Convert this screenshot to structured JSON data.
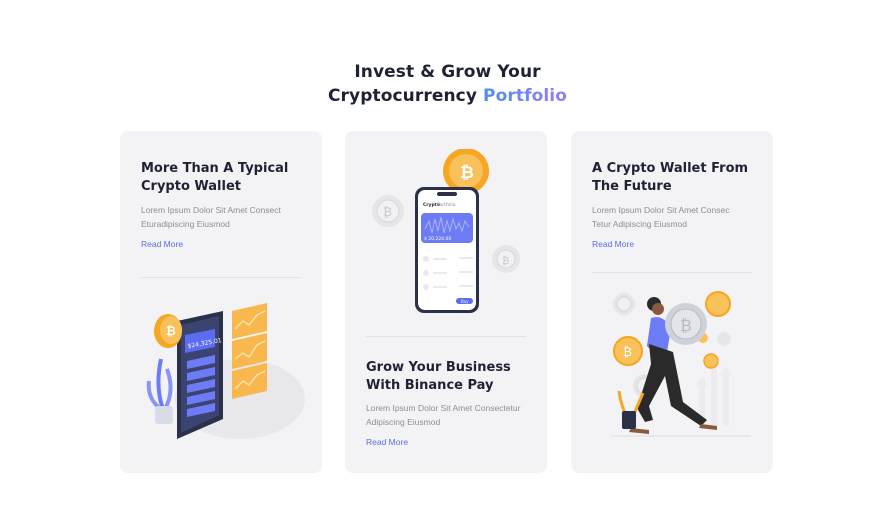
{
  "heading": {
    "line1": "Invest & Grow Your",
    "line2_main": "Cryptocurrency",
    "line2_accent": "Portfolio"
  },
  "cards": [
    {
      "title_line1": "More Than A Typical",
      "title_line2": "Crypto Wallet",
      "desc_line1": "Lorem Ipsum Dolor Sit Amet Consect",
      "desc_line2": "Eturadipiscing Eiusmod",
      "link": "Read More",
      "illustration": "phone-wallet-illustration"
    },
    {
      "title_line1": "Grow Your Business",
      "title_line2": "With Binance Pay",
      "desc_line1": "Lorem Ipsum Dolor Sit Amet Consectetur",
      "desc_line2": "Adipiscing Eiusmod",
      "link": "Read More",
      "illustration": "crypto-portfolio-app-illustration"
    },
    {
      "title_line1": "A Crypto Wallet From",
      "title_line2": "The Future",
      "desc_line1": "Lorem Ipsum Dolor Sit Amet Consec",
      "desc_line2": "Tetur Adipiscing Eiusmod",
      "link": "Read More",
      "illustration": "person-carrying-bitcoin-illustration"
    }
  ],
  "phone_app": {
    "title_bold": "Crypto",
    "title_rest": "Portfolio",
    "balance": "$ 20,224.00",
    "button": "Buy"
  },
  "wallet_app": {
    "balance": "$24,325.01"
  },
  "colors": {
    "accent_blue": "#5b6cf0",
    "portfolio_gradient_start": "#4f8ff0",
    "portfolio_gradient_end": "#9b7cf5",
    "coin_gold": "#f5b53d",
    "card_bg": "#f3f3f5"
  }
}
